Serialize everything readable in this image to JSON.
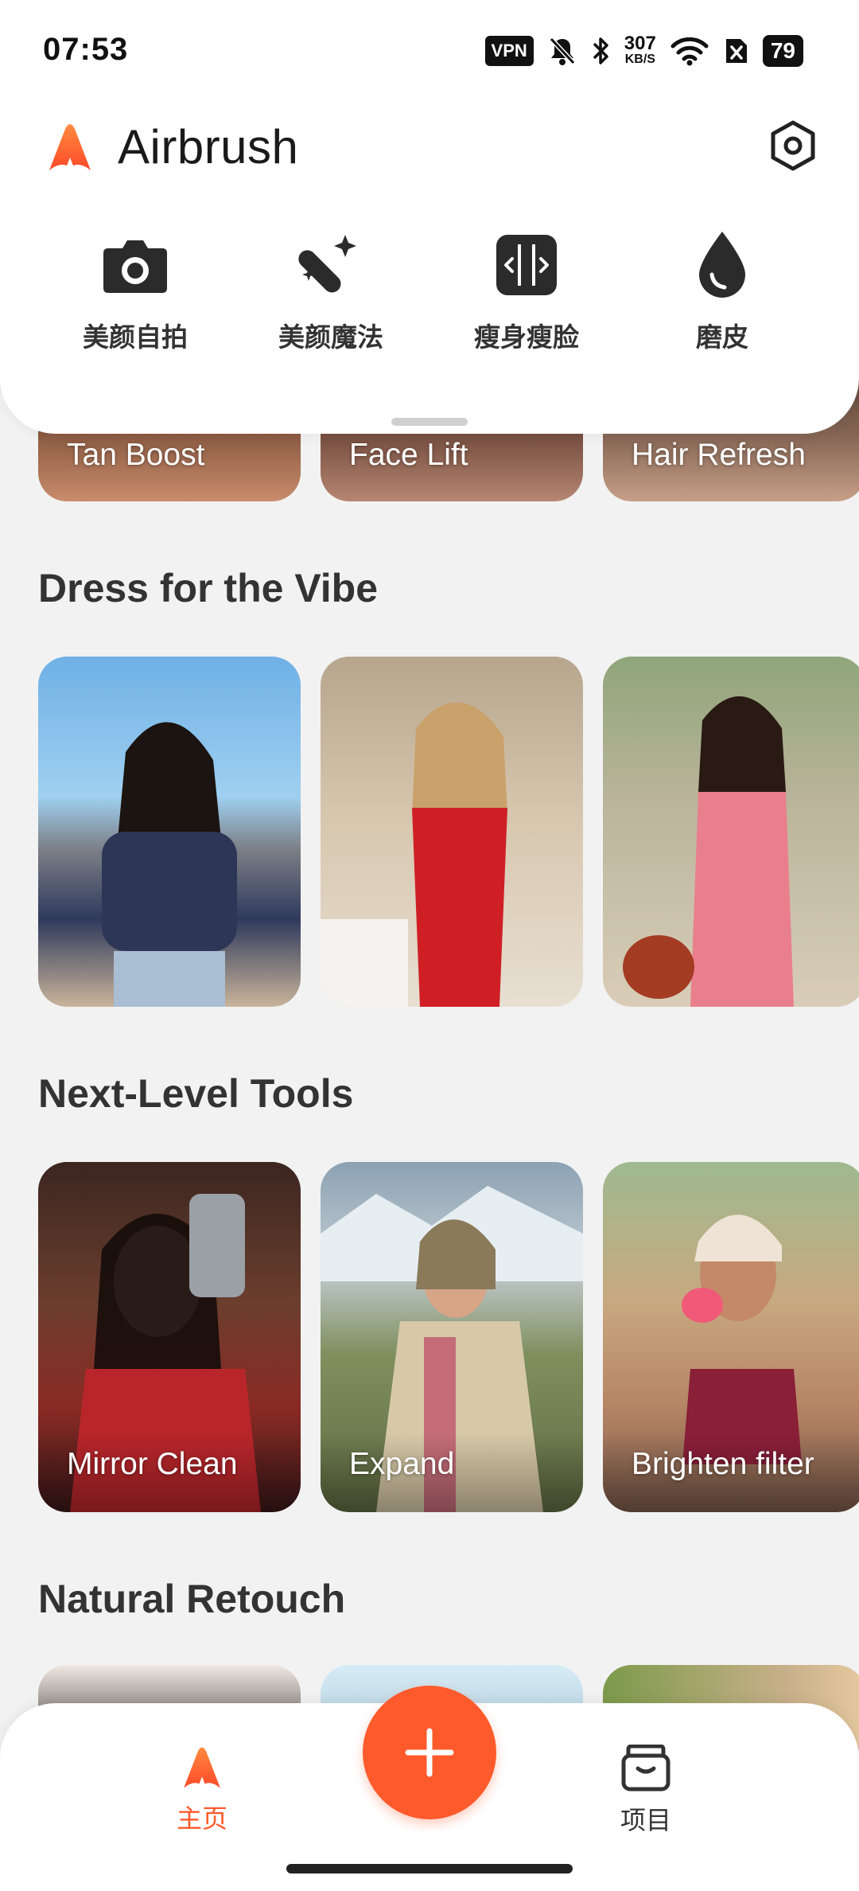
{
  "status_bar": {
    "time": "07:53",
    "vpn": "VPN",
    "speed_value": "307",
    "speed_unit": "KB/S",
    "battery": "79",
    "icons": [
      "mute-bell-icon",
      "bluetooth-icon",
      "wifi-icon",
      "sim-off-icon"
    ]
  },
  "app": {
    "title": "Airbrush",
    "accent_color": "#ff5a2b"
  },
  "quick_tools": [
    {
      "label": "美颜自拍",
      "icon": "camera-icon"
    },
    {
      "label": "美颜魔法",
      "icon": "magic-wand-icon"
    },
    {
      "label": "瘦身瘦脸",
      "icon": "slim-body-icon"
    },
    {
      "label": "磨皮",
      "icon": "drop-icon"
    }
  ],
  "top_row": [
    {
      "label": "Tan Boost"
    },
    {
      "label": "Face Lift"
    },
    {
      "label": "Hair Refresh"
    }
  ],
  "sections": {
    "dress": {
      "title": "Dress for the Vibe"
    },
    "tools": {
      "title": "Next-Level Tools",
      "items": [
        {
          "label": "Mirror Clean"
        },
        {
          "label": "Expand"
        },
        {
          "label": "Brighten filter"
        }
      ]
    },
    "retouch": {
      "title": "Natural Retouch"
    }
  },
  "bottom_nav": {
    "home": "主页",
    "projects": "项目"
  }
}
